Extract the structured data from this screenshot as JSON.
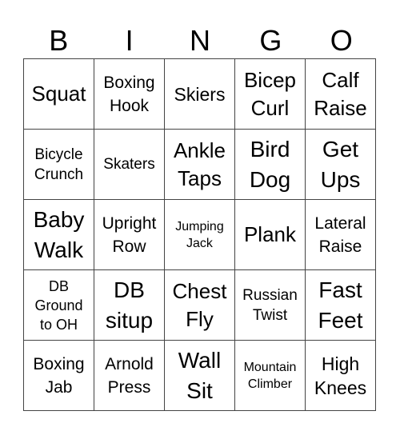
{
  "header": {
    "letters": [
      "B",
      "I",
      "N",
      "G",
      "O"
    ]
  },
  "grid": {
    "rows": [
      [
        "Squat",
        "Boxing\nHook",
        "Skiers",
        "Bicep\nCurl",
        "Calf\nRaise"
      ],
      [
        "Bicycle\nCrunch",
        "Skaters",
        "Ankle\nTaps",
        "Bird\nDog",
        "Get\nUps"
      ],
      [
        "Baby\nWalk",
        "Upright\nRow",
        "Jumping\nJack",
        "Plank",
        "Lateral\nRaise"
      ],
      [
        "DB\nGround\nto OH",
        "DB\nsitup",
        "Chest\nFly",
        "Russian\nTwist",
        "Fast\nFeet"
      ],
      [
        "Boxing\nJab",
        "Arnold\nPress",
        "Wall\nSit",
        "Mountain\nClimber",
        "High\nKnees"
      ]
    ]
  }
}
